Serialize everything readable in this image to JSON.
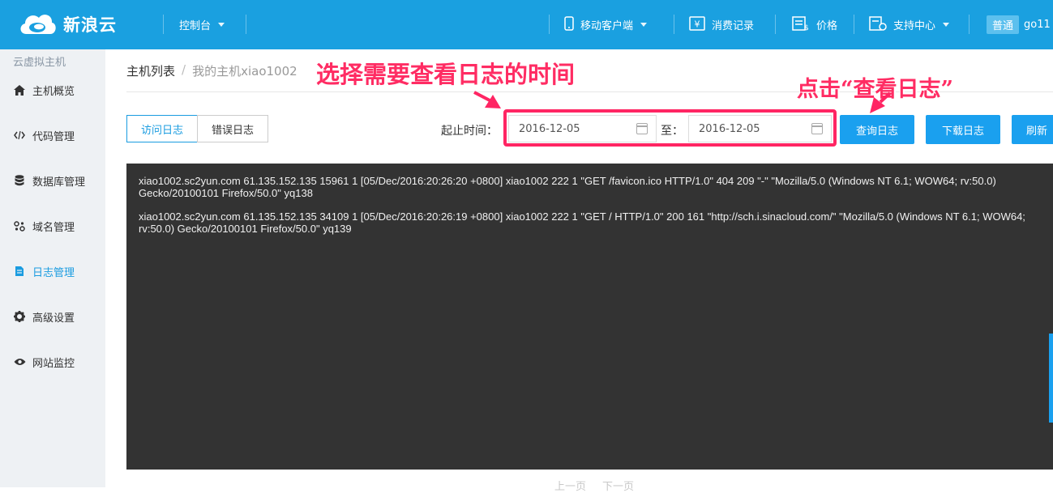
{
  "header": {
    "logo_text": "新浪云",
    "console": "控制台",
    "mobile_client": "移动客户端",
    "billing": "消费记录",
    "price": "价格",
    "support": "支持中心",
    "user_badge": "普通",
    "username": "go11"
  },
  "sidebar": {
    "title": "云虚拟主机",
    "items": [
      {
        "label": "主机概览",
        "icon": "home-icon"
      },
      {
        "label": "代码管理",
        "icon": "code-icon"
      },
      {
        "label": "数据库管理",
        "icon": "database-icon"
      },
      {
        "label": "域名管理",
        "icon": "domain-icon"
      },
      {
        "label": "日志管理",
        "icon": "log-icon",
        "active": true
      },
      {
        "label": "高级设置",
        "icon": "gear-icon"
      },
      {
        "label": "网站监控",
        "icon": "eye-icon"
      }
    ]
  },
  "breadcrumb": {
    "root": "主机列表",
    "separator": "/",
    "current": "我的主机xiao1002"
  },
  "tabs": {
    "access": "访问日志",
    "error": "错误日志"
  },
  "filter": {
    "label": "起止时间：",
    "start": "2016-12-05",
    "to": "至：",
    "end": "2016-12-05"
  },
  "buttons": {
    "query": "查询日志",
    "download": "下载日志",
    "refresh": "刷新"
  },
  "log": {
    "lines": [
      "xiao1002.sc2yun.com 61.135.152.135 15961 1 [05/Dec/2016:20:26:20 +0800] xiao1002 222 1 \"GET /favicon.ico HTTP/1.0\" 404 209 \"-\" \"Mozilla/5.0 (Windows NT 6.1; WOW64; rv:50.0) Gecko/20100101 Firefox/50.0\" yq138",
      "xiao1002.sc2yun.com 61.135.152.135 34109 1 [05/Dec/2016:20:26:19 +0800] xiao1002 222 1 \"GET / HTTP/1.0\" 200 161 \"http://sch.i.sinacloud.com/\" \"Mozilla/5.0 (Windows NT 6.1; WOW64; rv:50.0) Gecko/20100101 Firefox/50.0\" yq139"
    ]
  },
  "pager": {
    "prev": "上一页",
    "next": "下一页"
  },
  "annotations": {
    "select_time": "选择需要查看日志的时间",
    "click_query": "点击“查看日志”"
  },
  "colors": {
    "header_bg": "#1aa0e0",
    "accent": "#1a9ce0",
    "log_bg": "#333333",
    "annotation": "#ff2c63"
  }
}
